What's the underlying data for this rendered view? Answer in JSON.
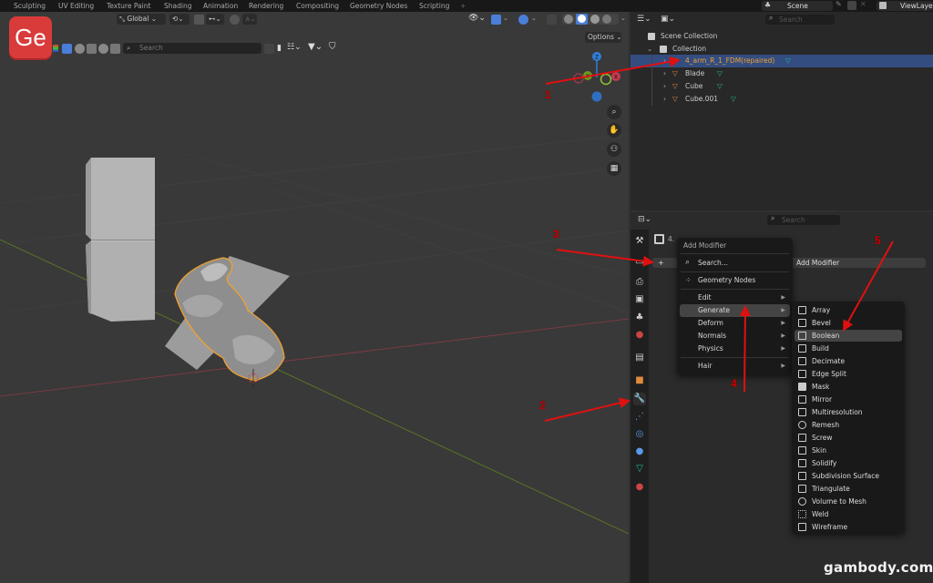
{
  "workspace_tabs": [
    "Sculpting",
    "UV Editing",
    "Texture Paint",
    "Shading",
    "Animation",
    "Rendering",
    "Compositing",
    "Geometry Nodes",
    "Scripting",
    "+"
  ],
  "topbar_right": {
    "scene_label": "Scene",
    "view_layer_label": "ViewLayer"
  },
  "logo": {
    "text": "Ge",
    "color": "#d93b3b"
  },
  "viewport_header": {
    "transform_orientation": "Global",
    "search_placeholder": "Search",
    "options_label": "Options"
  },
  "outliner": {
    "search_placeholder": "Search",
    "scene_collection": "Scene Collection",
    "collection": "Collection",
    "objects": [
      {
        "name": "4_arm_R_1_FDM(repaired)",
        "selected": true
      },
      {
        "name": "Blade",
        "selected": false
      },
      {
        "name": "Cube",
        "selected": false
      },
      {
        "name": "Cube.001",
        "selected": false
      }
    ]
  },
  "properties": {
    "search_placeholder": "Search",
    "object_name_truncated": "4.",
    "add_modifier_label": "Add Modifier",
    "add_button": "+"
  },
  "add_modifier_menu": {
    "title": "Add Modifier",
    "search": "Search...",
    "geometry_nodes": "Geometry Nodes",
    "categories": [
      {
        "label": "Edit",
        "highlighted": false
      },
      {
        "label": "Generate",
        "highlighted": true
      },
      {
        "label": "Deform",
        "highlighted": false
      },
      {
        "label": "Normals",
        "highlighted": false
      },
      {
        "label": "Physics",
        "highlighted": false
      }
    ],
    "hair": "Hair"
  },
  "generate_submenu": [
    {
      "label": "Array",
      "highlighted": false
    },
    {
      "label": "Bevel",
      "highlighted": false
    },
    {
      "label": "Boolean",
      "highlighted": true
    },
    {
      "label": "Build",
      "highlighted": false
    },
    {
      "label": "Decimate",
      "highlighted": false
    },
    {
      "label": "Edge Split",
      "highlighted": false
    },
    {
      "label": "Mask",
      "highlighted": false
    },
    {
      "label": "Mirror",
      "highlighted": false
    },
    {
      "label": "Multiresolution",
      "highlighted": false
    },
    {
      "label": "Remesh",
      "highlighted": false
    },
    {
      "label": "Screw",
      "highlighted": false
    },
    {
      "label": "Skin",
      "highlighted": false
    },
    {
      "label": "Solidify",
      "highlighted": false
    },
    {
      "label": "Subdivision Surface",
      "highlighted": false
    },
    {
      "label": "Triangulate",
      "highlighted": false
    },
    {
      "label": "Volume to Mesh",
      "highlighted": false
    },
    {
      "label": "Weld",
      "highlighted": false
    },
    {
      "label": "Wireframe",
      "highlighted": false
    }
  ],
  "annotations": [
    "1",
    "2",
    "3",
    "4",
    "5"
  ],
  "gizmo_axes": {
    "z": "Z",
    "y": "Y",
    "x": "X"
  },
  "watermark": "gambody.com",
  "colors": {
    "selection_orange": "#f0a030",
    "selected_row": "#334d80",
    "annotation_red": "#e01010",
    "mesh_icon": "#e08a3c",
    "data_icon": "#2ab39a"
  }
}
